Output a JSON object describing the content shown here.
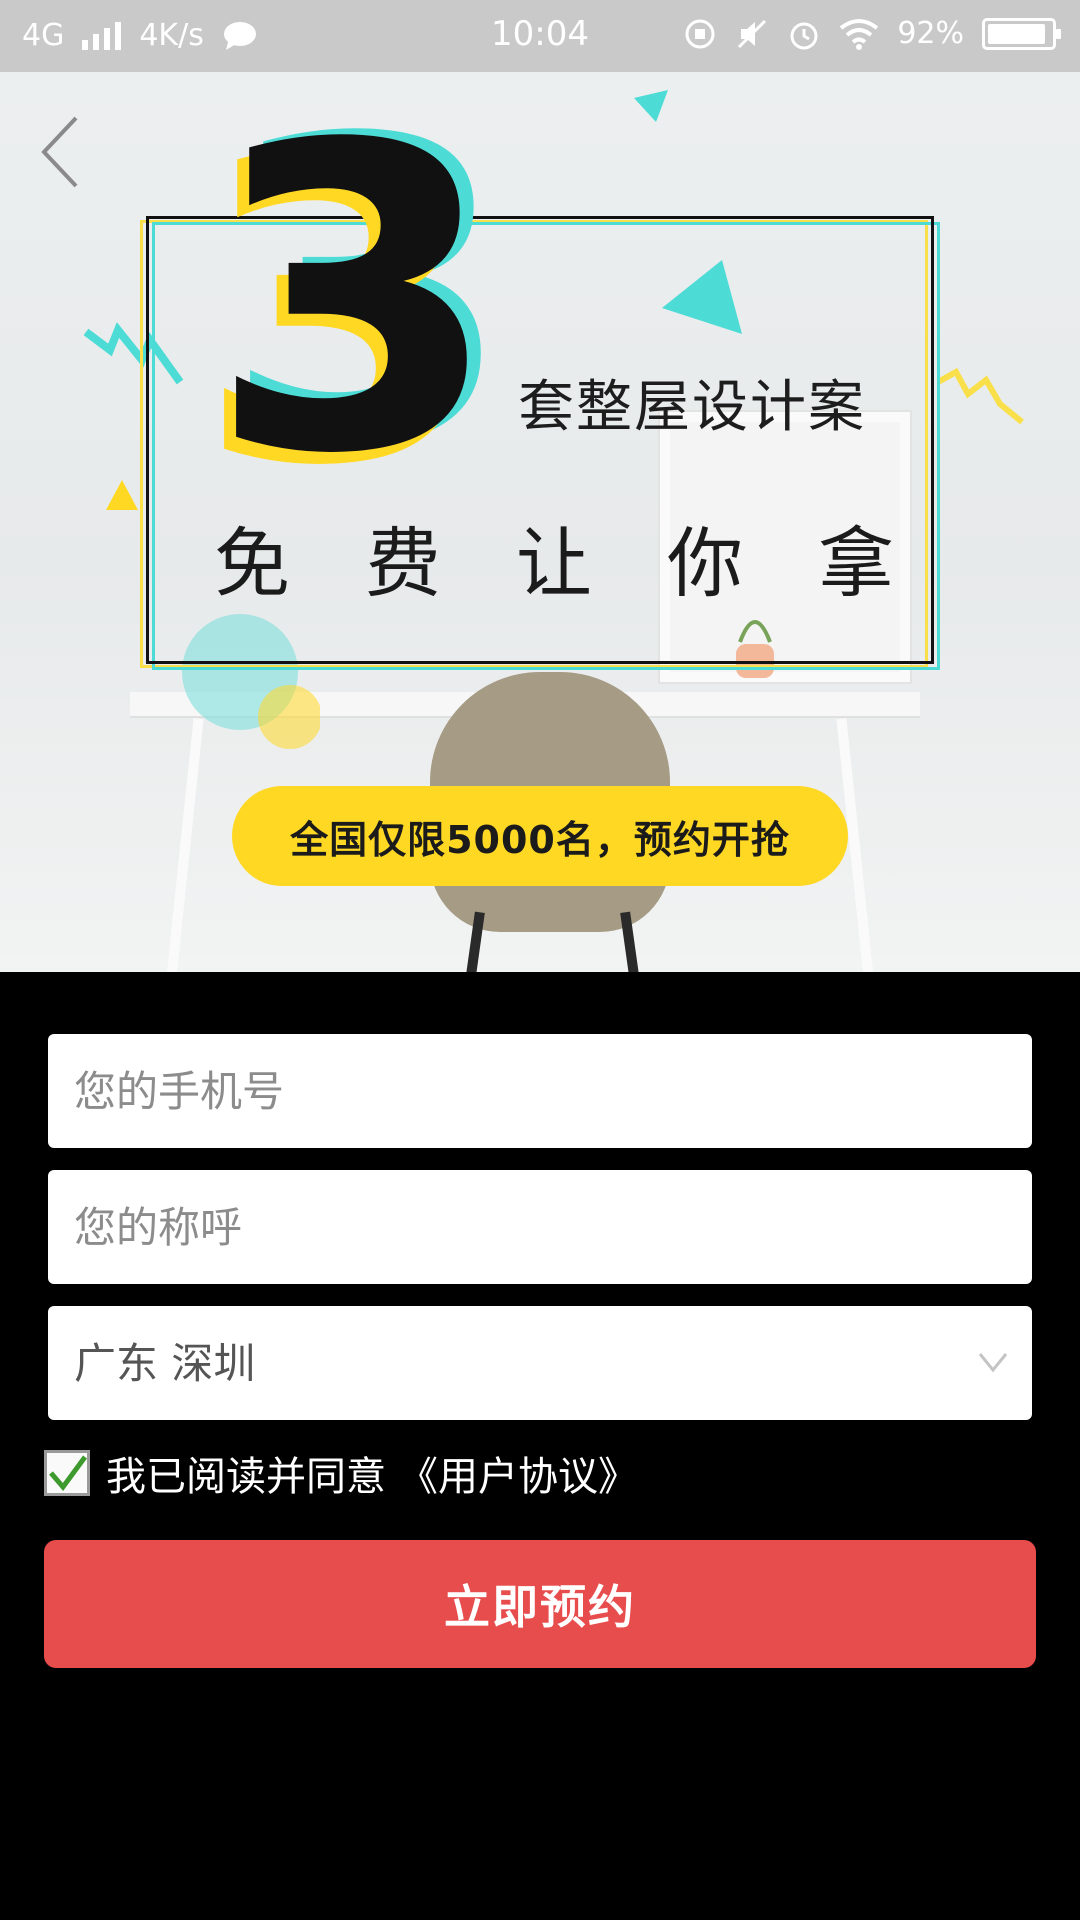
{
  "status_bar": {
    "network": "4G",
    "speed": "4K/s",
    "time": "10:04",
    "battery": "92%",
    "battery_level": 0.92
  },
  "hero": {
    "big_number": "3",
    "subtitle": "套整屋设计案",
    "title_chars": [
      "免",
      "费",
      "让",
      "你",
      "拿"
    ],
    "promo": "全国仅限5000名，预约开抢",
    "colors": {
      "accent_yellow": "#ffd824",
      "accent_cyan": "#4ddbd6"
    }
  },
  "form": {
    "phone_placeholder": "您的手机号",
    "name_placeholder": "您的称呼",
    "region_value": "广东 深圳",
    "agree_text": "我已阅读并同意",
    "agree_link": "《用户协议》",
    "agree_checked": true,
    "submit_label": "立即预约",
    "submit_color": "#e84d4d"
  }
}
